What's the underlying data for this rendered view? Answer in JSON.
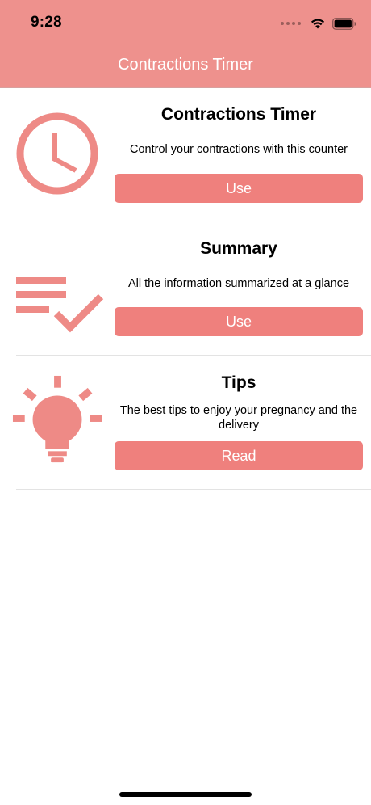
{
  "status_bar": {
    "time": "9:28",
    "wifi_icon": "wifi-icon",
    "battery_icon": "battery-icon"
  },
  "nav": {
    "title": "Contractions Timer"
  },
  "colors": {
    "accent": "#ef807d",
    "header": "#ee918d",
    "icon": "#ee8a86"
  },
  "menu": [
    {
      "icon": "clock-icon",
      "title": "Contractions Timer",
      "description": "Control your contractions with this counter",
      "button_label": "Use"
    },
    {
      "icon": "checklist-icon",
      "title": "Summary",
      "description": "All the information summarized at a glance",
      "button_label": "Use"
    },
    {
      "icon": "lightbulb-icon",
      "title": "Tips",
      "description": "The best tips to enjoy your pregnancy and the delivery",
      "button_label": "Read"
    }
  ]
}
